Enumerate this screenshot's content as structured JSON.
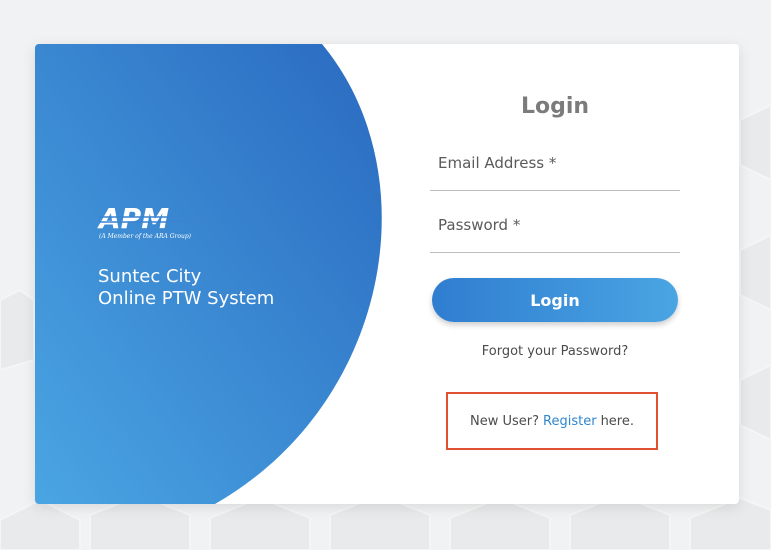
{
  "brand": {
    "logo_text": "APM",
    "logo_subtext": "(A Member of the ARA Group)",
    "tagline_line1": "Suntec City",
    "tagline_line2": "Online PTW System"
  },
  "login_form": {
    "title": "Login",
    "email_label": "Email Address *",
    "password_label": "Password *",
    "login_button": "Login",
    "forgot_password": "Forgot your Password?",
    "register_prefix": "New User?",
    "register_link": "Register",
    "register_suffix": "here."
  },
  "colors": {
    "brand_blue_dark": "#2a6fc2",
    "brand_blue_light": "#4aa5e3",
    "title_gray": "#7b7b7b",
    "highlight_red": "#e05032",
    "link_blue": "#2f86d0"
  }
}
